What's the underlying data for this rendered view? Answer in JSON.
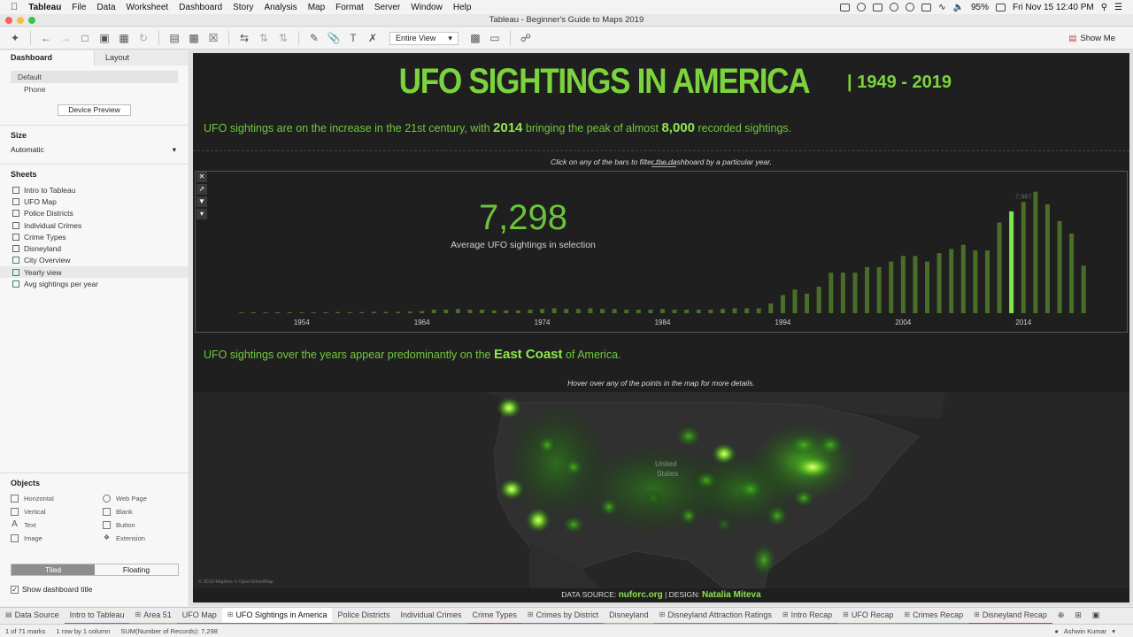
{
  "menubar": {
    "app": "Tableau",
    "items": [
      "File",
      "Data",
      "Worksheet",
      "Dashboard",
      "Story",
      "Analysis",
      "Map",
      "Format",
      "Server",
      "Window",
      "Help"
    ],
    "battery": "95%",
    "clock": "Fri Nov 15  12:40 PM"
  },
  "window": {
    "title": "Tableau - Beginner's Guide to Maps 2019"
  },
  "toolbar": {
    "fit_label": "Entire View",
    "show_me": "Show Me"
  },
  "sidebar": {
    "tab_dashboard": "Dashboard",
    "tab_layout": "Layout",
    "device_default": "Default",
    "device_phone": "Phone",
    "device_preview": "Device Preview",
    "size_heading": "Size",
    "size_value": "Automatic",
    "sheets_heading": "Sheets",
    "sheets": [
      "Intro to Tableau",
      "UFO Map",
      "Police Districts",
      "Individual Crimes",
      "Crime Types",
      "Disneyland",
      "City Overview",
      "Yearly view",
      "Avg sightings per year"
    ],
    "objects_heading": "Objects",
    "objects": [
      "Horizontal",
      "Web Page",
      "Vertical",
      "Blank",
      "Text",
      "Button",
      "Image",
      "Extension"
    ],
    "tiled": "Tiled",
    "floating": "Floating",
    "show_title": "Show dashboard title"
  },
  "dashboard": {
    "title": "UFO SIGHTINGS IN AMERICA",
    "years": "| 1949 - 2019",
    "sentence1_a": "UFO sightings are on the increase in the 21st century, with",
    "sentence1_year": "2014",
    "sentence1_b": "bringing the peak of almost",
    "sentence1_num": "8,000",
    "sentence1_c": "recorded sightings.",
    "hint_chart": "Click on any of the bars to filter the dashboard by a particular year.",
    "stat_value": "7,298",
    "stat_label": "Average UFO sightings in selection",
    "sentence2_a": "UFO sightings over the years appear predominantly on the",
    "sentence2_b": "East Coast",
    "sentence2_c": "of America.",
    "hint_map": "Hover over any of the points in the map for more details.",
    "map_label_1": "United",
    "map_label_2": "States",
    "attribution": "© 2019 Mapbox © OpenStreetMap",
    "source_a": "DATA SOURCE:",
    "source_b": "nuforc.org",
    "source_c": "| DESIGN:",
    "source_d": "Natalia Miteva"
  },
  "chart_data": {
    "type": "bar",
    "x": [
      1949,
      1950,
      1951,
      1952,
      1953,
      1954,
      1955,
      1956,
      1957,
      1958,
      1959,
      1960,
      1961,
      1962,
      1963,
      1964,
      1965,
      1966,
      1967,
      1968,
      1969,
      1970,
      1971,
      1972,
      1973,
      1974,
      1975,
      1976,
      1977,
      1978,
      1979,
      1980,
      1981,
      1982,
      1983,
      1984,
      1985,
      1986,
      1987,
      1988,
      1989,
      1990,
      1991,
      1992,
      1993,
      1994,
      1995,
      1996,
      1997,
      1998,
      1999,
      2000,
      2001,
      2002,
      2003,
      2004,
      2005,
      2006,
      2007,
      2008,
      2009,
      2010,
      2011,
      2012,
      2013,
      2014,
      2015,
      2016,
      2017,
      2018,
      2019
    ],
    "values": [
      40,
      30,
      40,
      40,
      50,
      50,
      50,
      60,
      80,
      70,
      80,
      100,
      90,
      100,
      120,
      150,
      250,
      250,
      300,
      250,
      250,
      200,
      200,
      200,
      250,
      300,
      350,
      300,
      300,
      350,
      300,
      300,
      250,
      250,
      250,
      300,
      250,
      250,
      250,
      250,
      300,
      350,
      350,
      350,
      700,
      1300,
      1700,
      1400,
      1900,
      2900,
      2900,
      2900,
      3300,
      3300,
      3700,
      4100,
      4100,
      3700,
      4300,
      4600,
      4900,
      4500,
      4500,
      6500,
      7298,
      7967,
      8700,
      7800,
      6600,
      5700,
      3400,
      1800
    ],
    "selected_year": 2013,
    "peak_label": "7,967",
    "peak_year": 2014,
    "x_ticks": [
      1954,
      1964,
      1974,
      1984,
      1994,
      2004,
      2014
    ],
    "ylim": [
      0,
      9000
    ],
    "bar_color": "#4a6e2a",
    "selected_color": "#7ee84a"
  },
  "tabs": [
    {
      "label": "Data Source",
      "icon": "db"
    },
    {
      "label": "Intro to Tableau",
      "icon": ""
    },
    {
      "label": "Area 51",
      "icon": "grid"
    },
    {
      "label": "UFO Map",
      "icon": ""
    },
    {
      "label": "UFO Sightings in America",
      "icon": "grid",
      "active": true
    },
    {
      "label": "Police Districts",
      "icon": ""
    },
    {
      "label": "Individual Crimes",
      "icon": ""
    },
    {
      "label": "Crime Types",
      "icon": ""
    },
    {
      "label": "Crimes by District",
      "icon": "grid"
    },
    {
      "label": "Disneyland",
      "icon": ""
    },
    {
      "label": "Disneyland Attraction Ratings",
      "icon": "grid"
    },
    {
      "label": "Intro Recap",
      "icon": "grid"
    },
    {
      "label": "UFO Recap",
      "icon": "grid"
    },
    {
      "label": "Crimes Recap",
      "icon": "grid"
    },
    {
      "label": "Disneyland Recap",
      "icon": "grid"
    }
  ],
  "status": {
    "marks": "1 of 71 marks",
    "dims": "1 row by 1 column",
    "sum": "SUM(Number of Records): 7,298",
    "user": "Ashwin Kumar"
  },
  "colors": {
    "accent_green": "#7cd43c",
    "dashboard_bg": "#1f1f1f"
  }
}
